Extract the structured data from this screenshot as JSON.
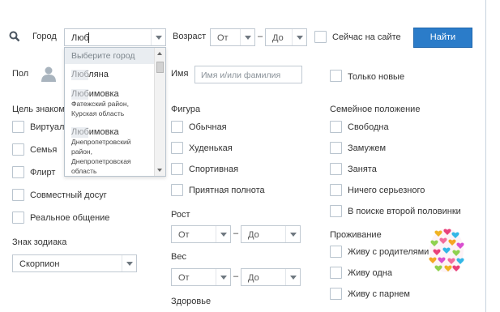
{
  "search": {
    "city_label": "Город",
    "city_value": "Люб",
    "age_label": "Возраст",
    "age_from": "От",
    "age_to": "До",
    "dash": "–",
    "online_label": "Сейчас на сайте",
    "find_button": "Найти"
  },
  "city_dropdown": {
    "header": "Выберите город",
    "items": [
      {
        "name": "Любляна",
        "region": ""
      },
      {
        "name": "Любимовка",
        "region": "Фатежский район, Курская область"
      },
      {
        "name": "Любимовка",
        "region": "Днепропетровский район, Днепропетровская область"
      }
    ],
    "match": "Люб"
  },
  "gender": {
    "label": "Пол"
  },
  "name": {
    "label": "Имя",
    "placeholder": "Имя и/или фамилия"
  },
  "only_new": {
    "label": "Только новые"
  },
  "goal": {
    "title": "Цель знакомства",
    "options": [
      "Виртуальное",
      "Семья",
      "Флирт",
      "Совместный досуг",
      "Реальное общение"
    ]
  },
  "zodiac": {
    "label": "Знак зодиака",
    "value": "Скорпион"
  },
  "figure": {
    "title": "Фигура",
    "options": [
      "Обычная",
      "Худенькая",
      "Спортивная",
      "Приятная полнота"
    ]
  },
  "height": {
    "label": "Рост",
    "from": "От",
    "to": "До"
  },
  "weight": {
    "label": "Вес",
    "from": "От",
    "to": "До"
  },
  "health": {
    "label": "Здоровье"
  },
  "family": {
    "title": "Семейное положение",
    "options": [
      "Свободна",
      "Замужем",
      "Занята",
      "Ничего серьезного",
      "В поиске второй половинки"
    ]
  },
  "living": {
    "title": "Проживание",
    "options": [
      "Живу с родителями",
      "Живу одна",
      "Живу с парнем"
    ]
  },
  "colors": {
    "accent": "#2b7cc9",
    "highlight": "#dde3e9"
  }
}
